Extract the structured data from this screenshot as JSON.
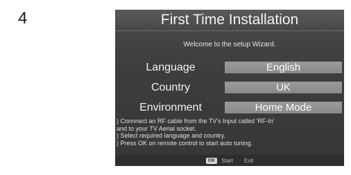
{
  "page_number": "4",
  "screen": {
    "title": "First Time Installation",
    "welcome": "Welcome to the setup Wizard.",
    "settings": [
      {
        "label": "Language",
        "value": "English"
      },
      {
        "label": "Country",
        "value": "UK"
      },
      {
        "label": "Environment",
        "value": "Home Mode"
      }
    ],
    "instructions": [
      ") Connnect an RF cable from the TV's Input called 'RF-In'",
      "and to your TV Aerial socket.",
      ") Select required language and country.",
      ") Press OK on remote control to start auto tuning."
    ],
    "footer": {
      "ok_key": "OK",
      "start_label": "Start",
      "exit_label": "Exit"
    }
  }
}
